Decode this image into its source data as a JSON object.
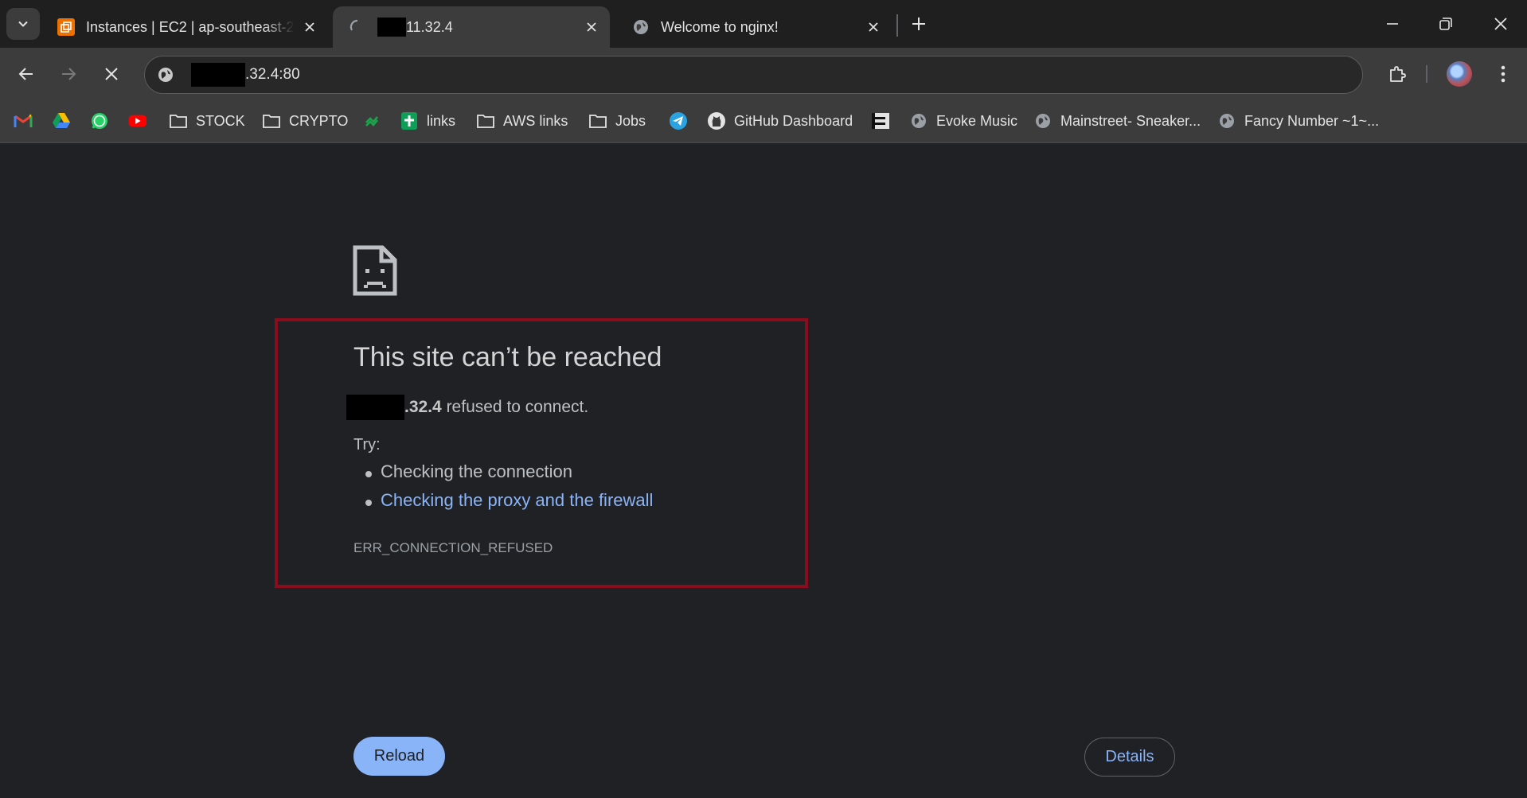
{
  "tabs": [
    {
      "title": "Instances | EC2 | ap-southeast-2",
      "icon": "aws-ec2-icon"
    },
    {
      "title": "11.32.4",
      "icon": "loading-spinner-icon",
      "active": true
    },
    {
      "title": "Welcome to nginx!",
      "icon": "globe-icon"
    }
  ],
  "address_bar": {
    "url_suffix": ".32.4:80"
  },
  "bookmarks": [
    {
      "label": "",
      "icon": "gmail-icon"
    },
    {
      "label": "",
      "icon": "google-drive-icon"
    },
    {
      "label": "",
      "icon": "whatsapp-icon"
    },
    {
      "label": "",
      "icon": "youtube-icon"
    },
    {
      "label": "STOCK",
      "icon": "folder-icon"
    },
    {
      "label": "CRYPTO",
      "icon": "folder-icon"
    },
    {
      "label": "",
      "icon": "crypto-site-icon"
    },
    {
      "label": "links",
      "icon": "google-sheets-icon"
    },
    {
      "label": "AWS links",
      "icon": "folder-icon"
    },
    {
      "label": "Jobs",
      "icon": "folder-icon"
    },
    {
      "label": "",
      "icon": "telegram-icon"
    },
    {
      "label": "GitHub Dashboard",
      "icon": "github-icon"
    },
    {
      "label": "",
      "icon": "brand-e-icon"
    },
    {
      "label": "Evoke Music",
      "icon": "globe-icon"
    },
    {
      "label": "Mainstreet- Sneaker...",
      "icon": "globe-icon"
    },
    {
      "label": "Fancy Number ~1~...",
      "icon": "globe-icon"
    }
  ],
  "error": {
    "title": "This site can’t be reached",
    "host_suffix": ".32.4",
    "message": "refused to connect.",
    "try_label": "Try:",
    "suggestions": [
      "Checking the connection",
      "Checking the proxy and the firewall"
    ],
    "code": "ERR_CONNECTION_REFUSED"
  },
  "buttons": {
    "reload": "Reload",
    "details": "Details"
  },
  "colors": {
    "page_bg": "#202124",
    "link": "#8ab4f8",
    "highlight_box": "#8b0c1c",
    "toolbar": "#3c3c3c"
  }
}
